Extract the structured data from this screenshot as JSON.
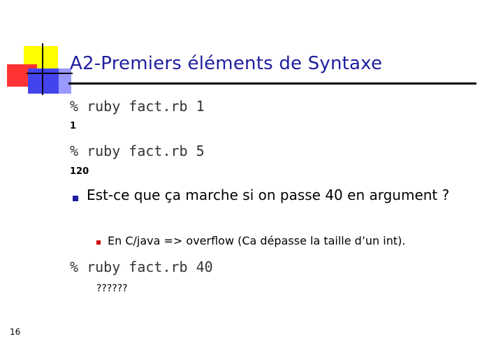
{
  "slide": {
    "title": "A2-Premiers éléments de Syntaxe",
    "page_number": "16",
    "colors": {
      "title": "#1e1e9e",
      "logo_yellow": "#ffff00",
      "logo_red": "#ff3333",
      "logo_blue": "#4444ee",
      "bullet_level1": "#1e1e9e",
      "bullet_level2": "#cc0000"
    }
  },
  "content": {
    "cmd1": "% ruby fact.rb 1",
    "out1": "1",
    "cmd2": "% ruby fact.rb 5",
    "out2": "120",
    "bullet1": "Est-ce que ça marche si on passe 40 en argument ?",
    "bullet2": "En C/java => overflow (Ca dépasse la taille d’un int).",
    "cmd3": "% ruby fact.rb 40",
    "out3": "??????"
  }
}
